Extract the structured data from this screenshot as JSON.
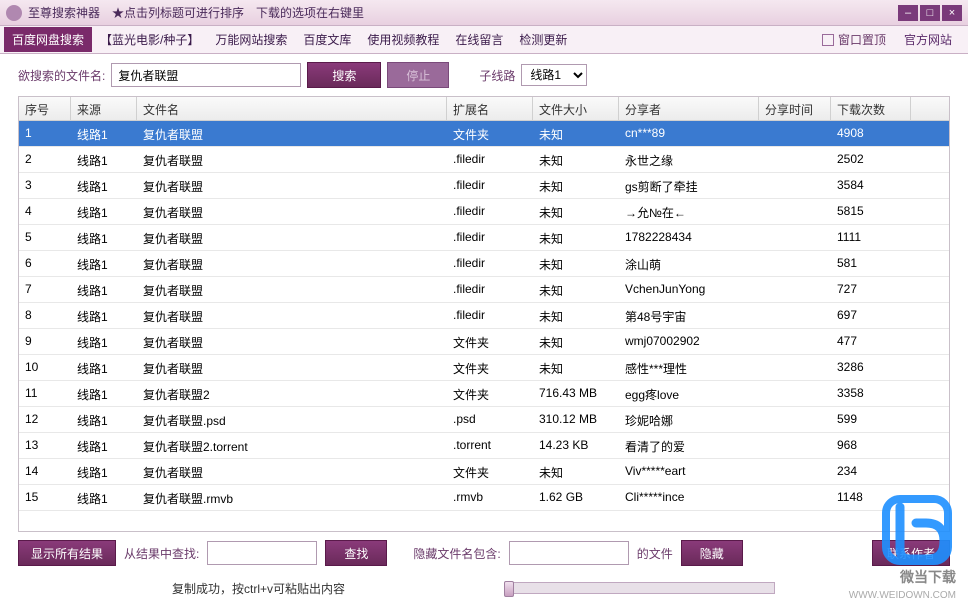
{
  "titlebar": {
    "app_name": "至尊搜索神器",
    "hint1": "★点击列标题可进行排序",
    "hint2": "下载的选项在右键里"
  },
  "window_buttons": {
    "min": "–",
    "max": "□",
    "close": "×"
  },
  "tabs": [
    "百度网盘搜索",
    "【蓝光电影/种子】",
    "万能网站搜索",
    "百度文库",
    "使用视频教程",
    "在线留言",
    "检测更新"
  ],
  "toprow": {
    "pin_label": "窗口置顶",
    "site_label": "官方网站"
  },
  "search": {
    "label": "欲搜索的文件名:",
    "input_value": "复仇者联盟",
    "btn_search": "搜索",
    "btn_stop": "停止",
    "sub_label": "子线路",
    "select_value": "线路1"
  },
  "columns": [
    "序号",
    "来源",
    "文件名",
    "扩展名",
    "文件大小",
    "分享者",
    "分享时间",
    "下载次数"
  ],
  "rows": [
    {
      "n": "1",
      "src": "线路1",
      "name": "复仇者联盟",
      "ext": "文件夹",
      "size": "未知",
      "sharer": "cn***89",
      "time": "",
      "dl": "4908",
      "sel": true
    },
    {
      "n": "2",
      "src": "线路1",
      "name": "复仇者联盟",
      "ext": ".filedir",
      "size": "未知",
      "sharer": "永世之缘",
      "time": "",
      "dl": "2502"
    },
    {
      "n": "3",
      "src": "线路1",
      "name": "复仇者联盟",
      "ext": ".filedir",
      "size": "未知",
      "sharer": "gs剪断了牵挂",
      "time": "",
      "dl": "3584"
    },
    {
      "n": "4",
      "src": "线路1",
      "name": "复仇者联盟",
      "ext": ".filedir",
      "size": "未知",
      "sharer": "→允№在←",
      "time": "",
      "dl": "5815"
    },
    {
      "n": "5",
      "src": "线路1",
      "name": "复仇者联盟",
      "ext": ".filedir",
      "size": "未知",
      "sharer": "1782228434",
      "time": "",
      "dl": "1111"
    },
    {
      "n": "6",
      "src": "线路1",
      "name": "复仇者联盟",
      "ext": ".filedir",
      "size": "未知",
      "sharer": "涂山萌",
      "time": "",
      "dl": "581"
    },
    {
      "n": "7",
      "src": "线路1",
      "name": "复仇者联盟",
      "ext": ".filedir",
      "size": "未知",
      "sharer": "VchenJunYong",
      "time": "",
      "dl": "727"
    },
    {
      "n": "8",
      "src": "线路1",
      "name": "复仇者联盟",
      "ext": ".filedir",
      "size": "未知",
      "sharer": "第48号宇宙",
      "time": "",
      "dl": "697"
    },
    {
      "n": "9",
      "src": "线路1",
      "name": "复仇者联盟",
      "ext": "文件夹",
      "size": "未知",
      "sharer": "wmj07002902",
      "time": "",
      "dl": "477"
    },
    {
      "n": "10",
      "src": "线路1",
      "name": "复仇者联盟",
      "ext": "文件夹",
      "size": "未知",
      "sharer": "感性***理性",
      "time": "",
      "dl": "3286"
    },
    {
      "n": "11",
      "src": "线路1",
      "name": "复仇者联盟2",
      "ext": "文件夹",
      "size": "716.43 MB",
      "sharer": "egg疼love",
      "time": "",
      "dl": "3358"
    },
    {
      "n": "12",
      "src": "线路1",
      "name": "复仇者联盟.psd",
      "ext": ".psd",
      "size": "310.12 MB",
      "sharer": "珍妮哈娜",
      "time": "",
      "dl": "599"
    },
    {
      "n": "13",
      "src": "线路1",
      "name": "复仇者联盟2.torrent",
      "ext": ".torrent",
      "size": "14.23 KB",
      "sharer": "看清了的爱",
      "time": "",
      "dl": "968"
    },
    {
      "n": "14",
      "src": "线路1",
      "name": "复仇者联盟",
      "ext": "文件夹",
      "size": "未知",
      "sharer": "Viv*****eart",
      "time": "",
      "dl": "234"
    },
    {
      "n": "15",
      "src": "线路1",
      "name": "复仇者联盟.rmvb",
      "ext": ".rmvb",
      "size": "1.62 GB",
      "sharer": "Cli*****ince",
      "time": "",
      "dl": "1148"
    }
  ],
  "bottom": {
    "show_all": "显示所有结果",
    "find_in_label": "从结果中查找:",
    "find_btn": "查找",
    "hide_label": "隐藏文件名包含:",
    "hide_suffix": "的文件",
    "hide_btn": "隐藏",
    "contact": "联系作者"
  },
  "status": {
    "text": "复制成功，按ctrl+v可粘贴出内容"
  },
  "watermark": {
    "name": "微当下载",
    "url": "WWW.WEIDOWN.COM"
  }
}
